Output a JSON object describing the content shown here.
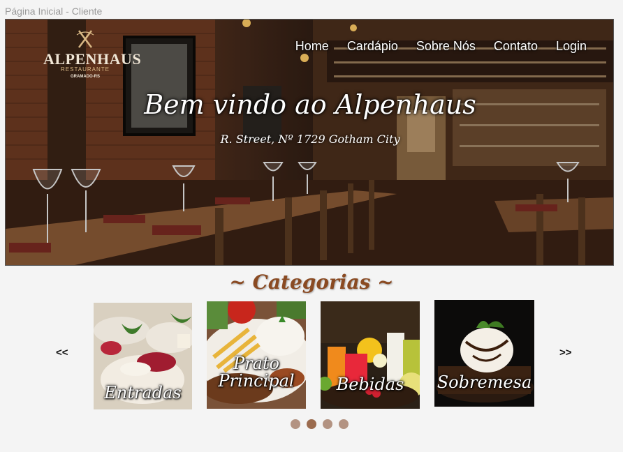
{
  "window": {
    "title": "Página Inicial - Cliente"
  },
  "logo": {
    "name": "ALPENHAUS",
    "subtitle": "RESTAURANTE",
    "city": "GRAMADO-RS"
  },
  "nav": {
    "items": [
      "Home",
      "Cardápio",
      "Sobre Nós",
      "Contato",
      "Login"
    ]
  },
  "hero": {
    "title": "Bem vindo ao Alpenhaus",
    "address": "R. Street, Nº 1729 Gotham City"
  },
  "categories": {
    "title": "~ Categorias ~",
    "prev_label": "<<",
    "next_label": ">>",
    "items": [
      {
        "label": "Entradas"
      },
      {
        "label": "Prato Principal"
      },
      {
        "label": "Bebidas"
      },
      {
        "label": "Sobremesa"
      }
    ],
    "active_dot": 2,
    "dot_count": 4
  },
  "colors": {
    "title_brown": "#8a4a22",
    "dot": "#b39382",
    "dot_active": "#9b6b4e"
  }
}
